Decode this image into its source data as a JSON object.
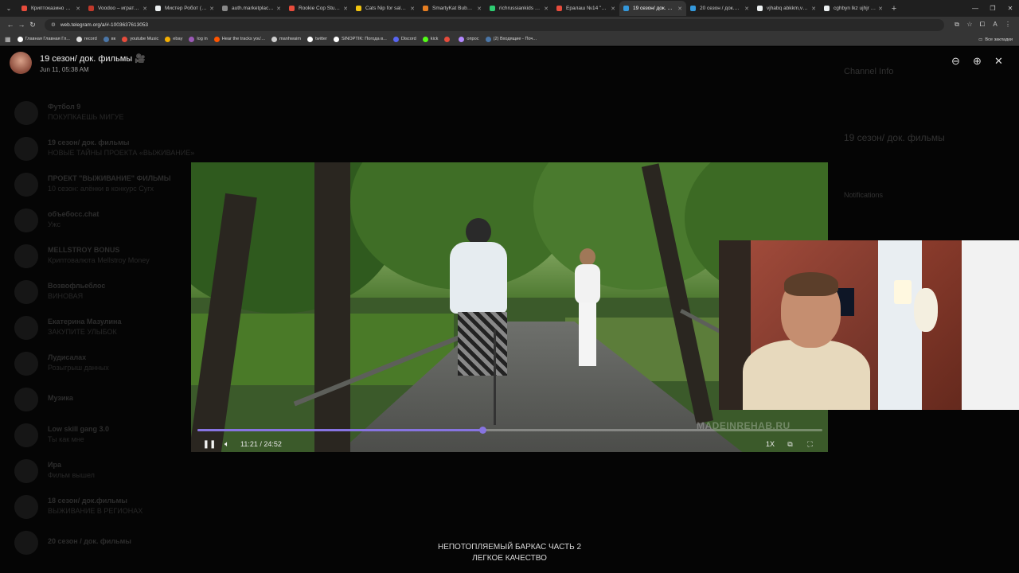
{
  "browser": {
    "tabs": [
      {
        "title": "Криптоказино онл...",
        "color": "#e74c3c"
      },
      {
        "title": "Voodoo – играть в...",
        "color": "#c0392b"
      },
      {
        "title": "Мистер Робот (1-4...",
        "color": "#ecf0f1"
      },
      {
        "title": "auth.marketplace.m...",
        "color": "#888888"
      },
      {
        "title": "Rookie Cop Stumbl...",
        "color": "#e74c3c"
      },
      {
        "title": "Cats Nip for sale | e...",
        "color": "#f1c40f"
      },
      {
        "title": "SmartyKat Bubble I...",
        "color": "#e67e22"
      },
      {
        "title": "richrussiankids Stre...",
        "color": "#2ecc71"
      },
      {
        "title": "Ералаш №14 \"Я с т...",
        "color": "#e74c3c"
      },
      {
        "title": "19 сезон/ док. ф...",
        "color": "#3498db",
        "active": true
      },
      {
        "title": "20 сезон / док.фил...",
        "color": "#3498db"
      },
      {
        "title": "vjhabq abkkm,v - G...",
        "color": "#ecf0f1"
      },
      {
        "title": "cghbyn lkz ujhjr - G...",
        "color": "#ecf0f1"
      }
    ],
    "url": "web.telegram.org/a/#-1003637613053",
    "bookmarks": [
      {
        "label": "Главная Главная Гл...",
        "color": "#ffffff"
      },
      {
        "label": "record",
        "color": "#dddddd"
      },
      {
        "label": "вк",
        "color": "#4a76a8"
      },
      {
        "label": "youtube Music",
        "color": "#e74c3c"
      },
      {
        "label": "ebay",
        "color": "#f5af02"
      },
      {
        "label": "log in",
        "color": "#9b59b6"
      },
      {
        "label": "Hear the tracks you'...",
        "color": "#ff5500"
      },
      {
        "label": "manhwaim",
        "color": "#cccccc"
      },
      {
        "label": "twitter",
        "color": "#ffffff"
      },
      {
        "label": "SINOPTIK: Погода в...",
        "color": "#ffffff"
      },
      {
        "label": "Discord",
        "color": "#5865f2"
      },
      {
        "label": "kick",
        "color": "#53fc18"
      },
      {
        "label": "",
        "color": "#e74c3c"
      },
      {
        "label": "опрос",
        "color": "#b388ff"
      },
      {
        "label": "(2) Входящие - Поч...",
        "color": "#4a76a8"
      }
    ],
    "all_bookmarks": "Все закладки"
  },
  "viewer": {
    "title": "19 сезон/ док. фильмы 🎥",
    "date": "Jun 11, 05:38 AM",
    "time": "11:21 / 24:52",
    "speed": "1X",
    "progress": 0.456,
    "watermark": "MADEINREHAB.RU",
    "caption_line1": "НЕПОТОПЛЯЕМЫЙ БАРКАС ЧАСТЬ 2",
    "caption_line2": "ЛЕГКОЕ КАЧЕСТВО"
  },
  "background": {
    "chats": [
      {
        "name": "Футбол 9",
        "preview": "ПОКУПКАЕШЬ МИГУЕ"
      },
      {
        "name": "19 сезон/ док. фильмы",
        "preview": "НОВЫЕ ТАЙНЫ ПРОЕКТА «ВЫЖИВАНИЕ»"
      },
      {
        "name": "ПРОЕКТ \"ВЫЖИВАНИЕ\" ФИЛЬМЫ",
        "preview": "10 сезон: алёнки в конкурс Сугх"
      },
      {
        "name": "объебосс.chat",
        "preview": "Ужс"
      },
      {
        "name": "MELLSTROY BONUS",
        "preview": "Криптовалюта Mellstroy Money"
      },
      {
        "name": "Возвофльеблос",
        "preview": "ВИНОВАЯ"
      },
      {
        "name": "Екатерина Мазулина",
        "preview": "ЗАКУПИТЕ УЛЫБОК"
      },
      {
        "name": "Лудисалах",
        "preview": "Розыгрыш данных"
      },
      {
        "name": "Музика",
        "preview": ""
      },
      {
        "name": "Low skill gang 3.0",
        "preview": "Ты как мне"
      },
      {
        "name": "Ира",
        "preview": "Фильм вышел"
      },
      {
        "name": "18 сезон/ док.фильмы",
        "preview": "ВЫЖИВАНИЕ В РЕГИОНАХ"
      },
      {
        "name": "20 сезон / док. фильмы",
        "preview": ""
      }
    ],
    "channel_info": "Channel Info",
    "channel_name": "19 сезон/ док. фильмы",
    "notifications": "Notifications"
  }
}
